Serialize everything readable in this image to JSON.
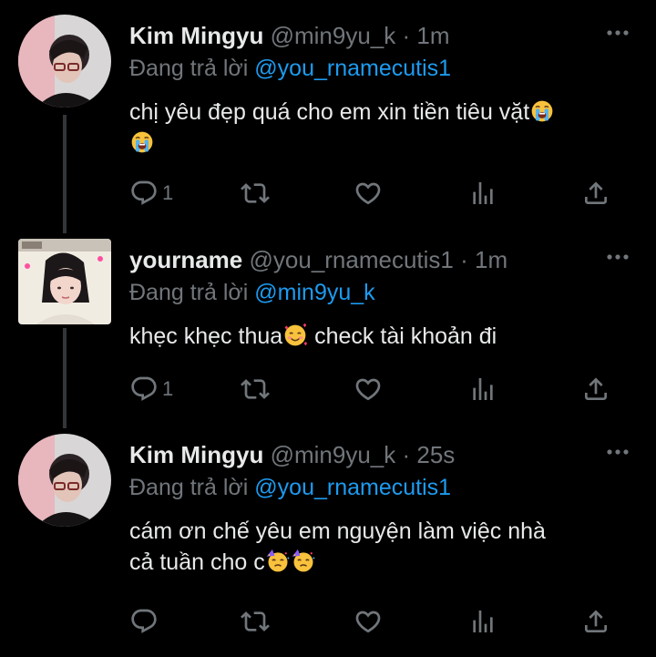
{
  "tweets": [
    {
      "name": "Kim Mingyu",
      "handle": "@min9yu_k",
      "separator": "·",
      "time": "1m",
      "reply_prefix": "Đang trả lời",
      "reply_to": "@you_rnamecutis1",
      "text_parts": [
        "chị yêu đẹp quá cho em xin tiền tiêu vặt"
      ],
      "emojis": [
        "loudly-crying-face",
        "loudly-crying-face"
      ],
      "reply_count": "1"
    },
    {
      "name": "yourname",
      "handle": "@you_rnamecutis1",
      "separator": "·",
      "time": "1m",
      "reply_prefix": "Đang trả lời",
      "reply_to": "@min9yu_k",
      "text_before": "khẹc khẹc thua",
      "text_after": " check tài khoản đi",
      "emojis": [
        "smiling-face-with-hearts"
      ],
      "reply_count": "1"
    },
    {
      "name": "Kim Mingyu",
      "handle": "@min9yu_k",
      "separator": "·",
      "time": "25s",
      "reply_prefix": "Đang trả lời",
      "reply_to": "@you_rnamecutis1",
      "text_line1": "cám ơn chế yêu em nguyện làm việc nhà",
      "text_line2": "cả tuần cho c",
      "emojis": [
        "partying-face",
        "partying-face"
      ],
      "reply_count": ""
    }
  ],
  "colors": {
    "background": "#000000",
    "text": "#e7e9ea",
    "secondary": "#71767b",
    "link": "#1d9bf0",
    "thread_line": "#333639"
  },
  "icons": [
    "reply-icon",
    "retweet-icon",
    "like-icon",
    "views-icon",
    "share-icon",
    "more-icon"
  ]
}
